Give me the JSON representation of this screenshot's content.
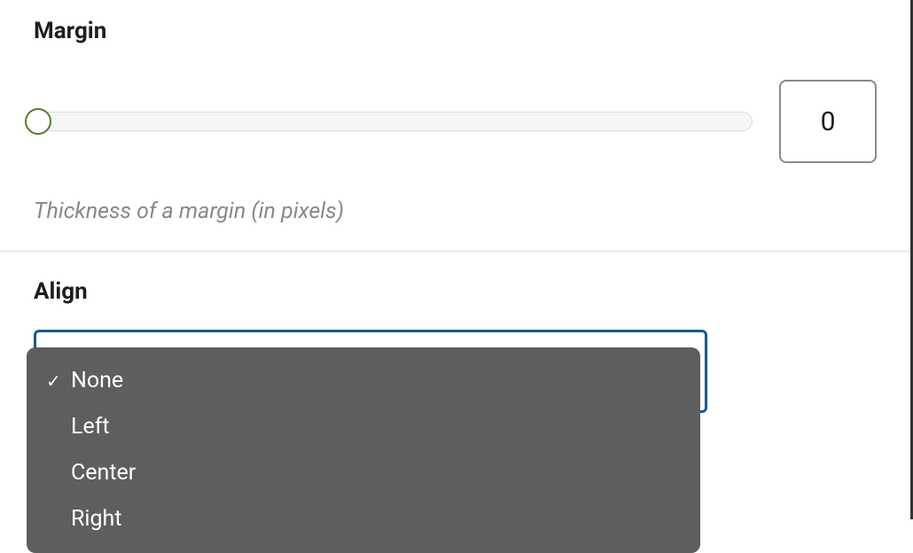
{
  "margin": {
    "label": "Margin",
    "value": "0",
    "helper": "Thickness of a margin (in pixels)"
  },
  "align": {
    "label": "Align",
    "selected": "None",
    "options": [
      {
        "label": "None",
        "checked": true
      },
      {
        "label": "Left",
        "checked": false
      },
      {
        "label": "Center",
        "checked": false
      },
      {
        "label": "Right",
        "checked": false
      }
    ]
  }
}
